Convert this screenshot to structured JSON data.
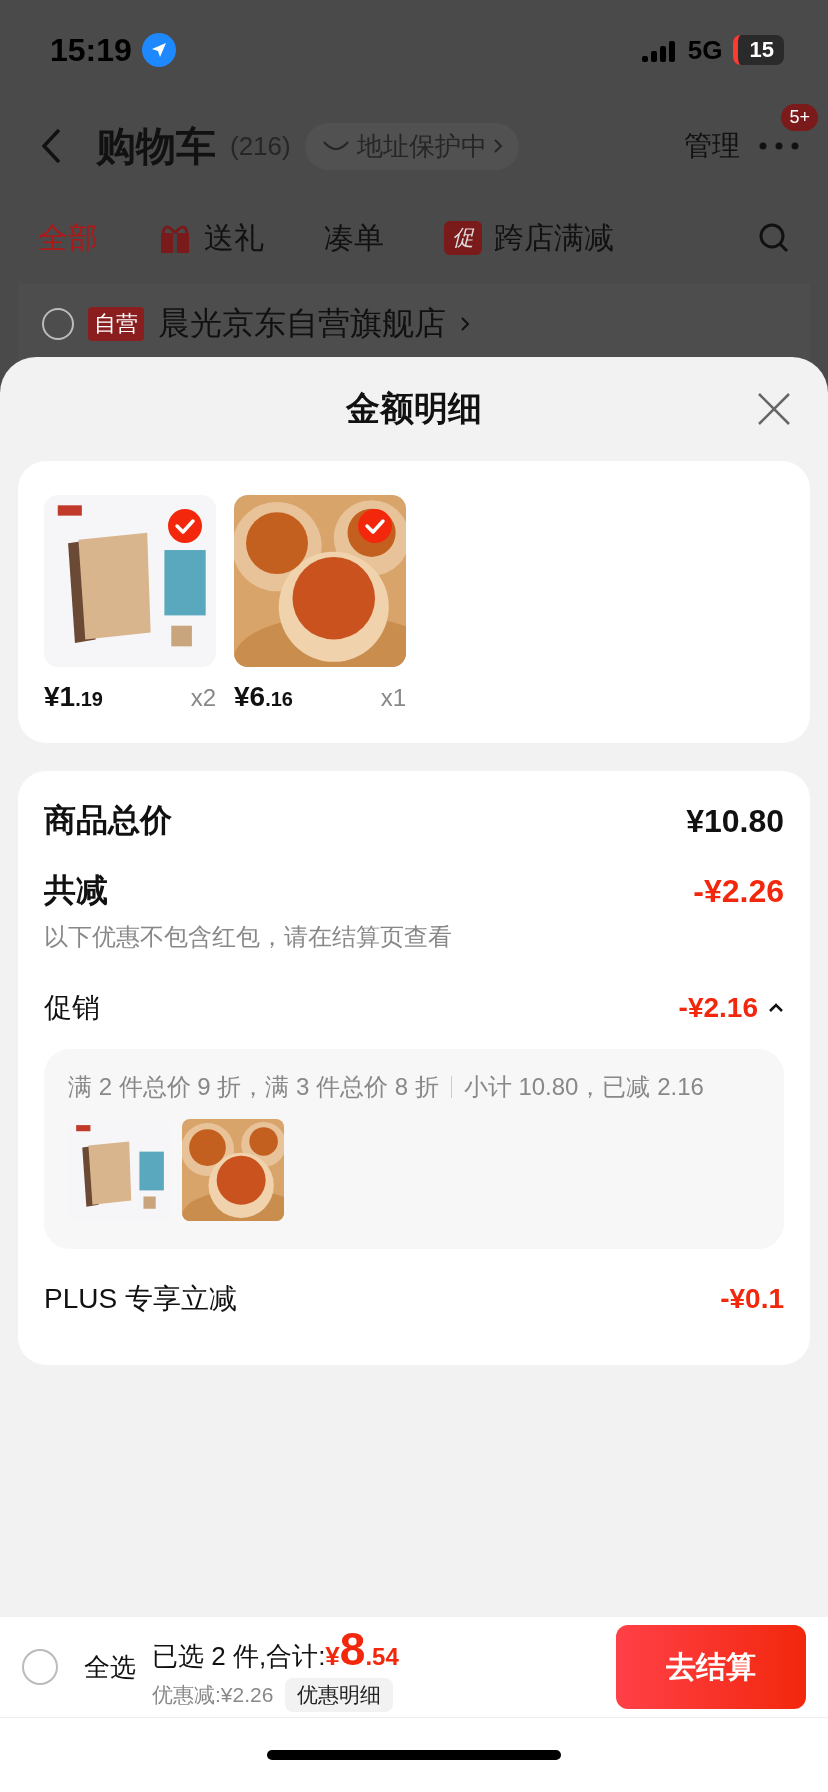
{
  "status_bar": {
    "time": "15:19",
    "network": "5G",
    "battery": "15"
  },
  "nav": {
    "title": "购物车",
    "count": "(216)",
    "address_pill": "地址保护中",
    "manage": "管理",
    "more_badge": "5+"
  },
  "tabs": [
    {
      "label": "全部",
      "selected": true,
      "kind": "plain"
    },
    {
      "label": "送礼",
      "selected": false,
      "kind": "gift"
    },
    {
      "label": "凑单",
      "selected": false,
      "kind": "plain"
    },
    {
      "label": "跨店满减",
      "selected": false,
      "kind": "promo",
      "badge": "促"
    }
  ],
  "store": {
    "checked": false,
    "tag": "自营",
    "name": "晨光京东自营旗舰店"
  },
  "sheet": {
    "title": "金额明细",
    "items": [
      {
        "kind": "picture",
        "price_int": "¥1",
        "price_dec": ".19",
        "qty": "x2",
        "checked": true
      },
      {
        "kind": "picture",
        "price_int": "¥6",
        "price_dec": ".16",
        "qty": "x1",
        "checked": true
      }
    ],
    "total": {
      "label": "商品总价",
      "value": "¥10.80"
    },
    "reduce": {
      "label": "共减",
      "value": "-¥2.26",
      "note": "以下优惠不包含红包，请在结算页查看"
    },
    "promo": {
      "label": "促销",
      "value": "-¥2.16",
      "expanded": true,
      "rule": "满 2 件总价 9 折，满 3 件总价 8 折",
      "subtotal": "小计 10.80，已减 2.16"
    },
    "plus": {
      "label": "PLUS 专享立减",
      "value": "-¥0.1"
    }
  },
  "bottom_bar": {
    "select_all": {
      "label": "全选",
      "checked": false
    },
    "selected_text": "已选 2 件,合计:",
    "total_symbol": "¥",
    "total_int": "8",
    "total_dec": ".54",
    "discount": "优惠减:¥2.26",
    "detail_button": "优惠明细",
    "checkout": "去结算"
  }
}
